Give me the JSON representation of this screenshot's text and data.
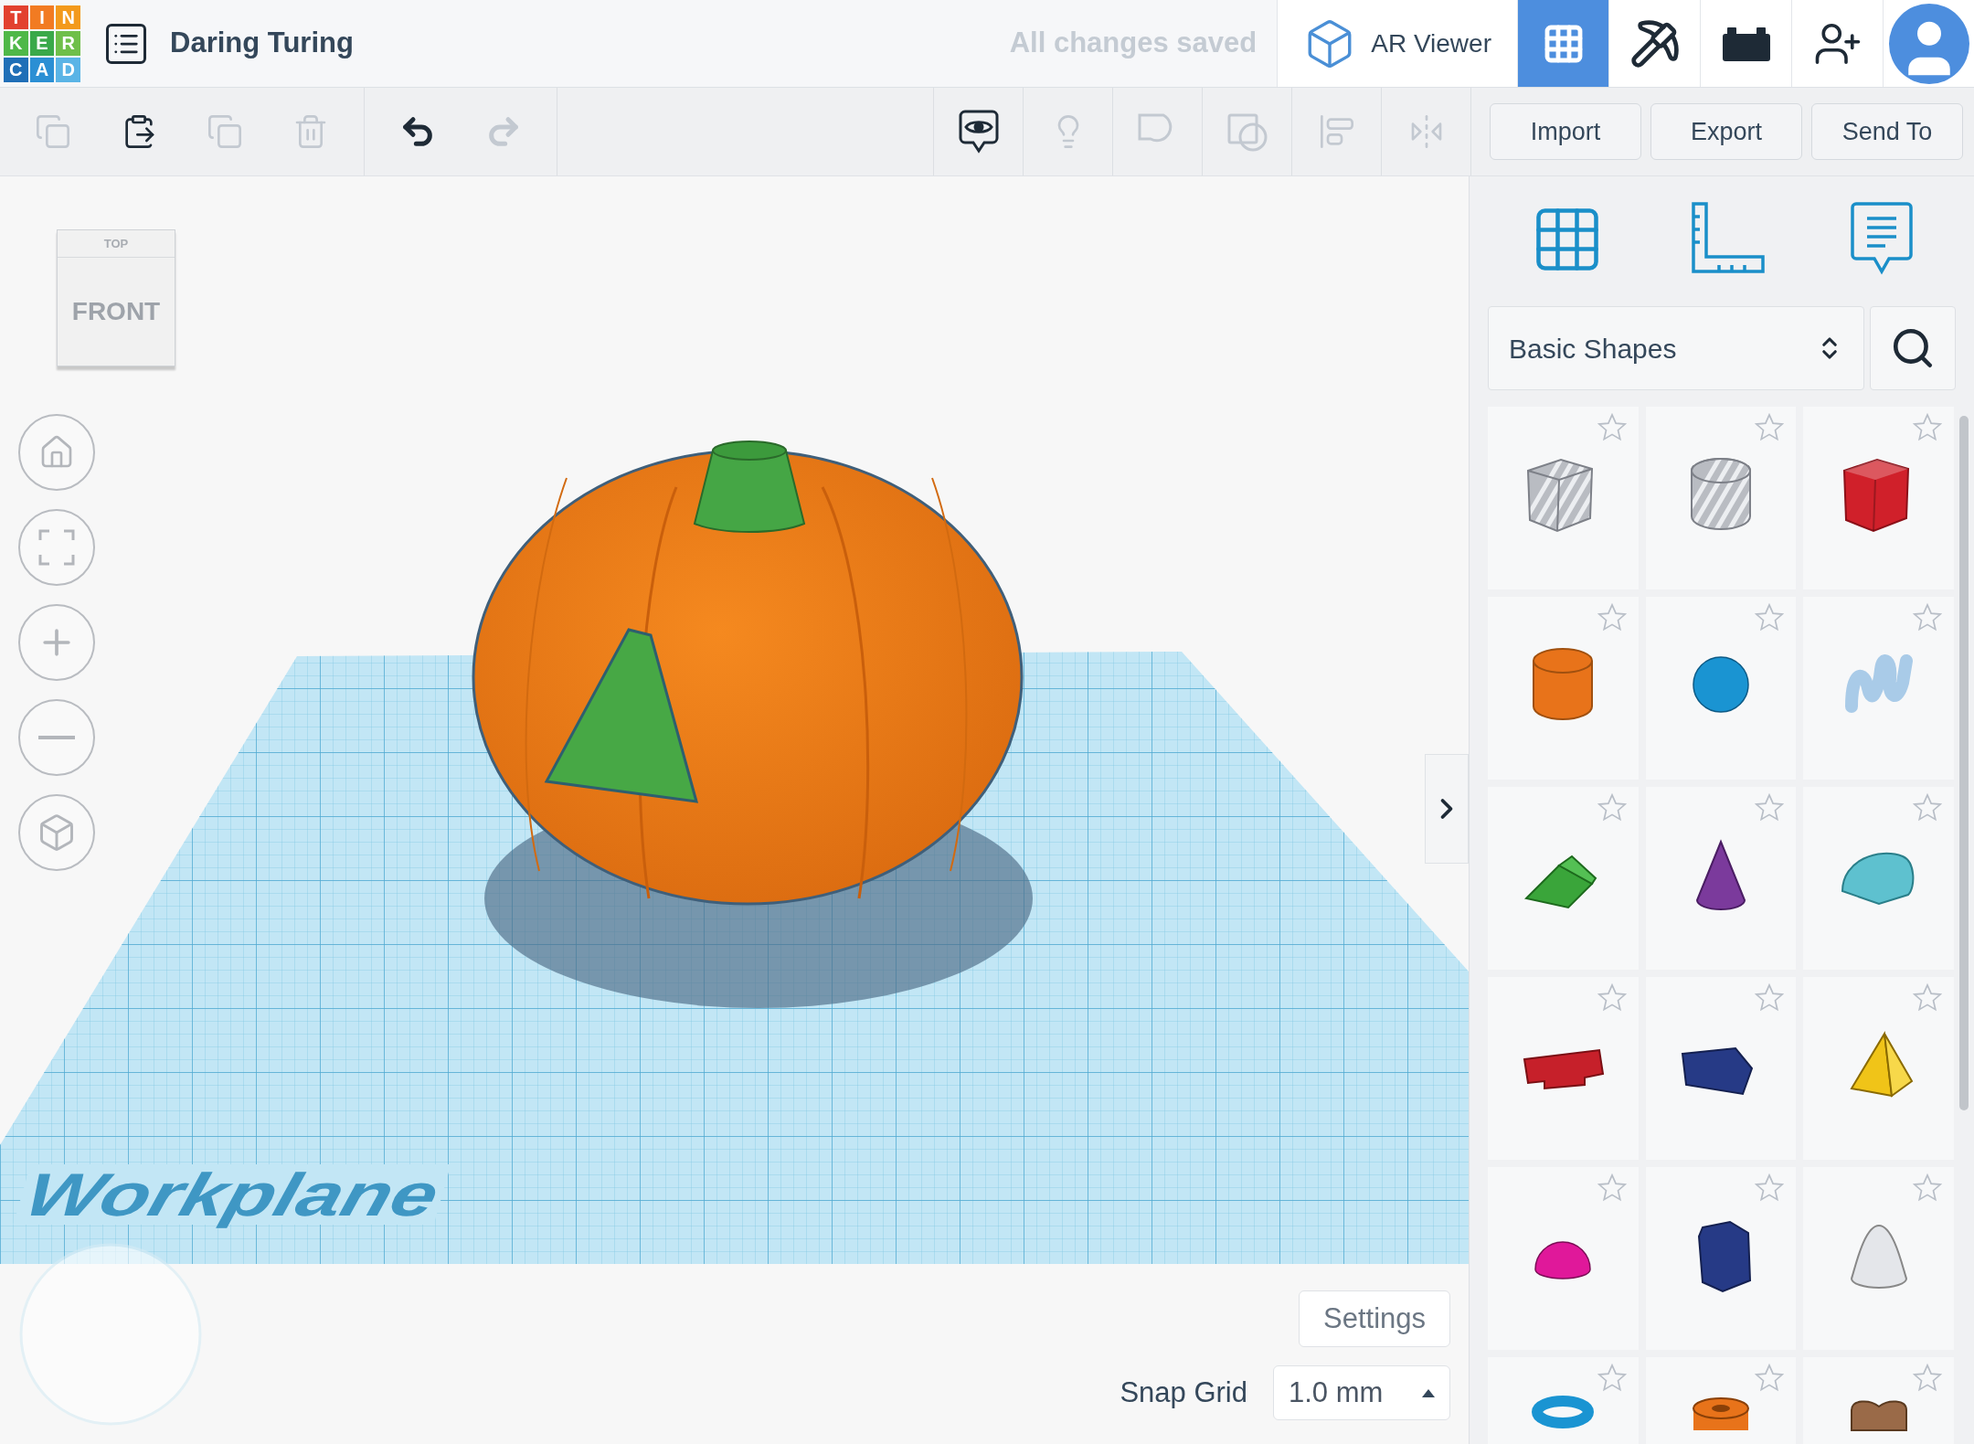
{
  "header": {
    "logo_letters": [
      {
        "letter": "T",
        "color": "#e2412f"
      },
      {
        "letter": "I",
        "color": "#f27b22"
      },
      {
        "letter": "N",
        "color": "#f39a1c"
      },
      {
        "letter": "K",
        "color": "#4fb848"
      },
      {
        "letter": "E",
        "color": "#3aa94a"
      },
      {
        "letter": "R",
        "color": "#6fbf4a"
      },
      {
        "letter": "C",
        "color": "#1f6fb7"
      },
      {
        "letter": "A",
        "color": "#2b8fd4"
      },
      {
        "letter": "D",
        "color": "#5ab4e6"
      }
    ],
    "project_title": "Daring Turing",
    "save_status": "All changes saved",
    "ar_viewer": "AR Viewer",
    "views": [
      {
        "kind": "grid",
        "selected": true
      },
      {
        "kind": "pickaxe",
        "selected": false
      },
      {
        "kind": "bricks",
        "selected": false
      }
    ]
  },
  "toolbar": {
    "edit_tools": [
      {
        "kind": "copy",
        "disabled": true
      },
      {
        "kind": "paste",
        "disabled": false
      },
      {
        "kind": "duplicate",
        "disabled": true
      },
      {
        "kind": "delete",
        "disabled": true
      }
    ],
    "history": [
      {
        "kind": "undo",
        "disabled": false
      },
      {
        "kind": "redo",
        "disabled": true
      }
    ],
    "view_tools": [
      {
        "kind": "notes",
        "disabled": false
      },
      {
        "kind": "bulb",
        "disabled": true
      },
      {
        "kind": "solid",
        "disabled": true
      },
      {
        "kind": "hole",
        "disabled": true
      },
      {
        "kind": "align",
        "disabled": true
      },
      {
        "kind": "mirror",
        "disabled": true
      }
    ],
    "buttons": [
      "Import",
      "Export",
      "Send To"
    ]
  },
  "view_cube": {
    "top": "TOP",
    "front": "FRONT"
  },
  "workplane_label": "Workplane",
  "settings_button": "Settings",
  "snap_grid": {
    "label": "Snap Grid",
    "value": "1.0 mm"
  },
  "shapes_panel": {
    "category": "Basic Shapes",
    "shapes": [
      {
        "kind": "box-hole",
        "color": "#b9bcc2",
        "favorite": false
      },
      {
        "kind": "cylinder-hole",
        "color": "#b9bcc2",
        "favorite": false
      },
      {
        "kind": "box",
        "color": "#d0202a",
        "favorite": false
      },
      {
        "kind": "cylinder",
        "color": "#e8731a",
        "favorite": false
      },
      {
        "kind": "sphere",
        "color": "#1a94d2",
        "favorite": false
      },
      {
        "kind": "scribble",
        "color": "#a9cbe8",
        "favorite": false
      },
      {
        "kind": "roof",
        "color": "#3aa53a",
        "favorite": false
      },
      {
        "kind": "cone",
        "color": "#7b3a9c",
        "favorite": false
      },
      {
        "kind": "round-roof",
        "color": "#5ec1cf",
        "favorite": false
      },
      {
        "kind": "text",
        "color": "#c6202a",
        "favorite": false
      },
      {
        "kind": "wedge",
        "color": "#263a86",
        "favorite": false
      },
      {
        "kind": "pyramid",
        "color": "#f0c418",
        "favorite": false
      },
      {
        "kind": "half-sphere",
        "color": "#e0189a",
        "favorite": false
      },
      {
        "kind": "polygon",
        "color": "#263a86",
        "favorite": false
      },
      {
        "kind": "paraboloid",
        "color": "#e4e6ea",
        "favorite": false
      },
      {
        "kind": "torus",
        "color": "#1a94d2",
        "favorite": false
      },
      {
        "kind": "tube",
        "color": "#e8731a",
        "favorite": false
      },
      {
        "kind": "heart",
        "color": "#9a6a48",
        "favorite": false
      }
    ]
  }
}
